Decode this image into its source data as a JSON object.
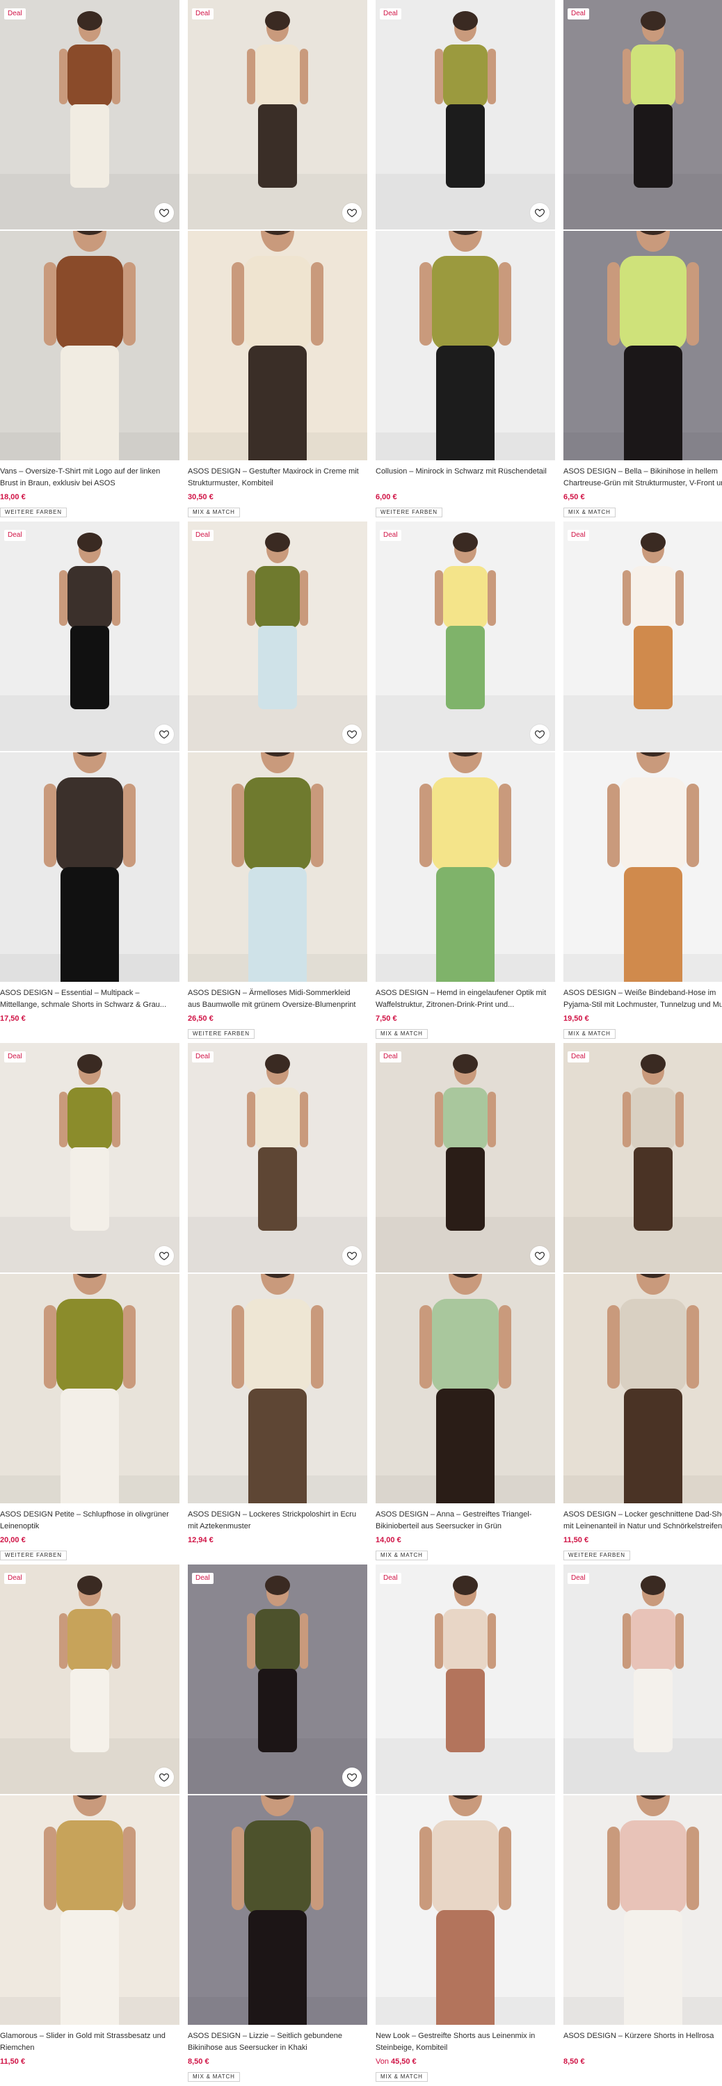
{
  "labels": {
    "deal": "Deal"
  },
  "products": [
    {
      "title": "Vans – Oversize-T-Shirt mit Logo auf der linken Brust in Braun, exklusiv bei ASOS",
      "price": "18,00 €",
      "price_prefix": "",
      "badge": "WEITERE FARBEN",
      "bg_top": "#dcdad6",
      "bg_bottom": "#d9d7d2",
      "subject": "#8a4b2a",
      "subject2": "#f1ece2",
      "heart": true
    },
    {
      "title": "ASOS DESIGN – Gestufter Maxirock in Creme mit Strukturmuster, Kombiteil",
      "price": "30,50 €",
      "price_prefix": "",
      "badge": "MIX & MATCH",
      "bg_top": "#e9e4dc",
      "bg_bottom": "#efe6d8",
      "subject": "#efe4d0",
      "subject2": "#3a2e27",
      "heart": true
    },
    {
      "title": "Collusion – Minirock in Schwarz mit Rüschendetail",
      "price": "6,00 €",
      "price_prefix": "",
      "badge": "WEITERE FARBEN",
      "bg_top": "#ececec",
      "bg_bottom": "#eeeeee",
      "subject": "#9b9a3e",
      "subject2": "#1c1c1c",
      "heart": true
    },
    {
      "title": "ASOS DESIGN – Bella – Bikinihose in hellem Chartreuse-Grün mit Strukturmuster, V-Front und Ring...",
      "price": "6,50 €",
      "price_prefix": "",
      "badge": "MIX & MATCH",
      "bg_top": "#8e8b92",
      "bg_bottom": "#8a8890",
      "subject": "#cfe27a",
      "subject2": "#1b1718",
      "heart": false
    },
    {
      "title": "ASOS DESIGN – Essential – Multipack – Mittellange, schmale Shorts in Schwarz & Grau...",
      "price": "17,50 €",
      "price_prefix": "",
      "badge": "",
      "bg_top": "#eeeeee",
      "bg_bottom": "#eaeaea",
      "subject": "#3b302b",
      "subject2": "#111111",
      "heart": true
    },
    {
      "title": "ASOS DESIGN – Ärmelloses Midi-Sommerkleid aus Baumwolle mit grünem Oversize-Blumenprint",
      "price": "26,50 €",
      "price_prefix": "",
      "badge": "WEITERE FARBEN",
      "bg_top": "#eee9e1",
      "bg_bottom": "#ebe6dd",
      "subject": "#6f7a2e",
      "subject2": "#cfe2e8",
      "heart": true
    },
    {
      "title": "ASOS DESIGN – Hemd in eingelaufener Optik mit Waffelstruktur, Zitronen-Drink-Print und...",
      "price": "7,50 €",
      "price_prefix": "",
      "badge": "MIX & MATCH",
      "bg_top": "#f2f2f2",
      "bg_bottom": "#f1f1f1",
      "subject": "#f4e48a",
      "subject2": "#7fb36a",
      "heart": true
    },
    {
      "title": "ASOS DESIGN – Weiße Bindeband-Hose im Pyjama-Stil mit Lochmuster, Tunnelzug und Muster in...",
      "price": "19,50 €",
      "price_prefix": "",
      "badge": "MIX & MATCH",
      "bg_top": "#f3f3f3",
      "bg_bottom": "#f4f4f4",
      "subject": "#f7f1ea",
      "subject2": "#d08a4c",
      "heart": false
    },
    {
      "title": "ASOS DESIGN Petite – Schlupfhose in olivgrüner Leinenoptik",
      "price": "20,00 €",
      "price_prefix": "",
      "badge": "WEITERE FARBEN",
      "bg_top": "#ece8e2",
      "bg_bottom": "#e8e3da",
      "subject": "#8b8c2b",
      "subject2": "#f3efe8",
      "heart": true
    },
    {
      "title": "ASOS DESIGN – Lockeres Strickpoloshirt in Ecru mit Aztekenmuster",
      "price": "12,94 €",
      "price_prefix": "",
      "badge": "",
      "bg_top": "#ebe7e2",
      "bg_bottom": "#e9e5df",
      "subject": "#eee6d4",
      "subject2": "#5e4634",
      "heart": true
    },
    {
      "title": "ASOS DESIGN – Anna – Gestreiftes Triangel-Bikinioberteil aus Seersucker in Grün",
      "price": "14,00 €",
      "price_prefix": "",
      "badge": "MIX & MATCH",
      "bg_top": "#e3ddd5",
      "bg_bottom": "#e3ded6",
      "subject": "#a9c79d",
      "subject2": "#2a1d17",
      "heart": true
    },
    {
      "title": "ASOS DESIGN – Locker geschnittene Dad-Shorts mit Leinenanteil in Natur und Schnörkelstreifen",
      "price": "11,50 €",
      "price_prefix": "",
      "badge": "WEITERE FARBEN",
      "bg_top": "#e4ddd2",
      "bg_bottom": "#e6dfd4",
      "subject": "#d9d0c2",
      "subject2": "#4a3325",
      "heart": false
    },
    {
      "title": "Glamorous – Slider in Gold mit Strassbesatz und Riemchen",
      "price": "11,50 €",
      "price_prefix": "",
      "badge": "",
      "bg_top": "#e9e2d8",
      "bg_bottom": "#efe9e0",
      "subject": "#c7a35a",
      "subject2": "#f5f1ea",
      "heart": true
    },
    {
      "title": "ASOS DESIGN – Lizzie – Seitlich gebundene Bikinihose aus Seersucker in Khaki",
      "price": "8,50 €",
      "price_prefix": "",
      "badge": "MIX & MATCH",
      "bg_top": "#8a8790",
      "bg_bottom": "#898690",
      "subject": "#4d522c",
      "subject2": "#1c1516",
      "heart": true
    },
    {
      "title": "New Look – Gestreifte Shorts aus Leinenmix in Steinbeige, Kombiteil",
      "price": "45,50 €",
      "price_prefix": "Von",
      "badge": "MIX & MATCH",
      "bg_top": "#f2f2f2",
      "bg_bottom": "#f3f3f3",
      "subject": "#e8d6c6",
      "subject2": "#b3745c",
      "heart": false
    },
    {
      "title": "ASOS DESIGN – Kürzere Shorts in Hellrosa",
      "price": "8,50 €",
      "price_prefix": "",
      "badge": "",
      "bg_top": "#ececec",
      "bg_bottom": "#f0eeec",
      "subject": "#e8c3b8",
      "subject2": "#f4f1ec",
      "heart": false
    }
  ]
}
